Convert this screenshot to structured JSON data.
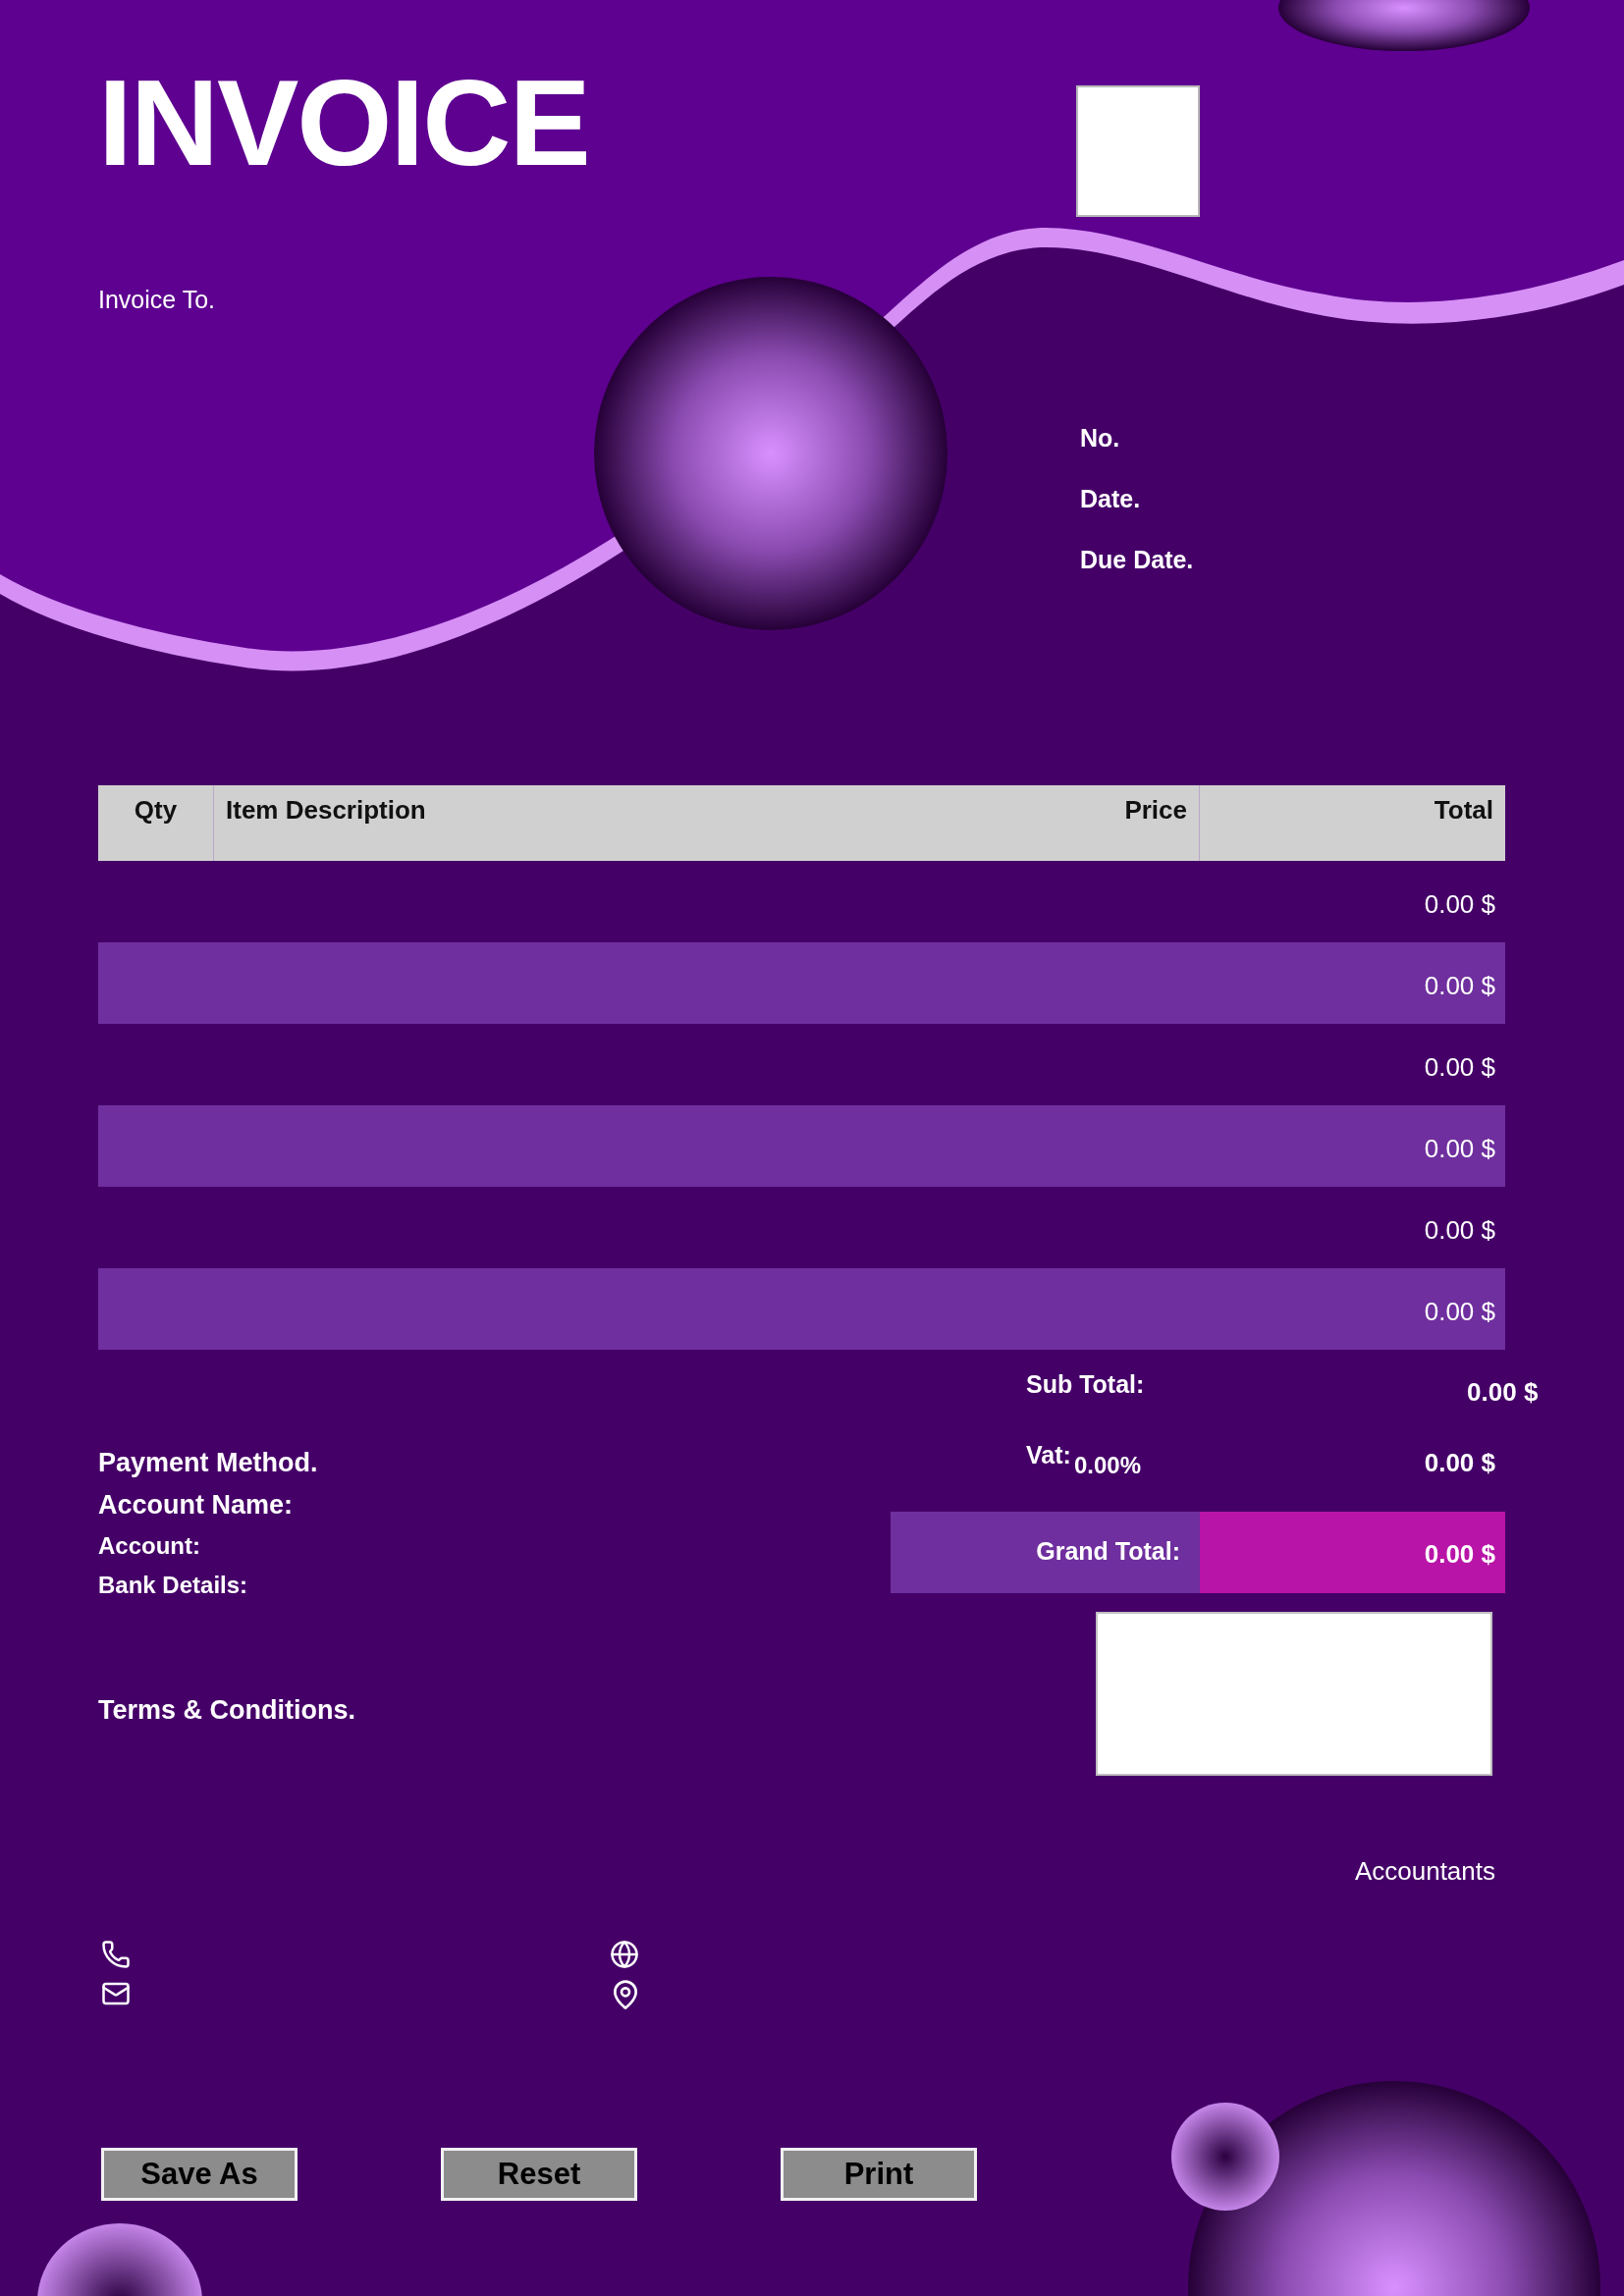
{
  "header": {
    "title": "INVOICE",
    "invoice_to_label": "Invoice To.",
    "meta_labels": [
      "No.",
      "Date.",
      "Due Date."
    ]
  },
  "table": {
    "columns": [
      "Qty",
      "Item Description",
      "Price",
      "Total"
    ],
    "rows": [
      {
        "total": "0.00 $"
      },
      {
        "total": "0.00 $"
      },
      {
        "total": "0.00 $"
      },
      {
        "total": "0.00 $"
      },
      {
        "total": "0.00 $"
      },
      {
        "total": "0.00 $"
      }
    ]
  },
  "totals": {
    "subtotal_label": "Sub Total:",
    "subtotal": "0.00 $",
    "vat_label": "Vat:",
    "vat_rate": "0.00%",
    "vat": "0.00 $",
    "grand_total_label": "Grand Total:",
    "grand_total": "0.00 $"
  },
  "payment": [
    {
      "label": "Payment Method.",
      "kind": "large"
    },
    {
      "label": "Account Name:",
      "kind": "large"
    },
    {
      "label": "Account:",
      "kind": "small"
    },
    {
      "label": "Bank Details:",
      "kind": "small"
    }
  ],
  "terms_label": "Terms & Conditions.",
  "signature_caption": "Accountants",
  "buttons": [
    "Save As",
    "Reset",
    "Print"
  ]
}
